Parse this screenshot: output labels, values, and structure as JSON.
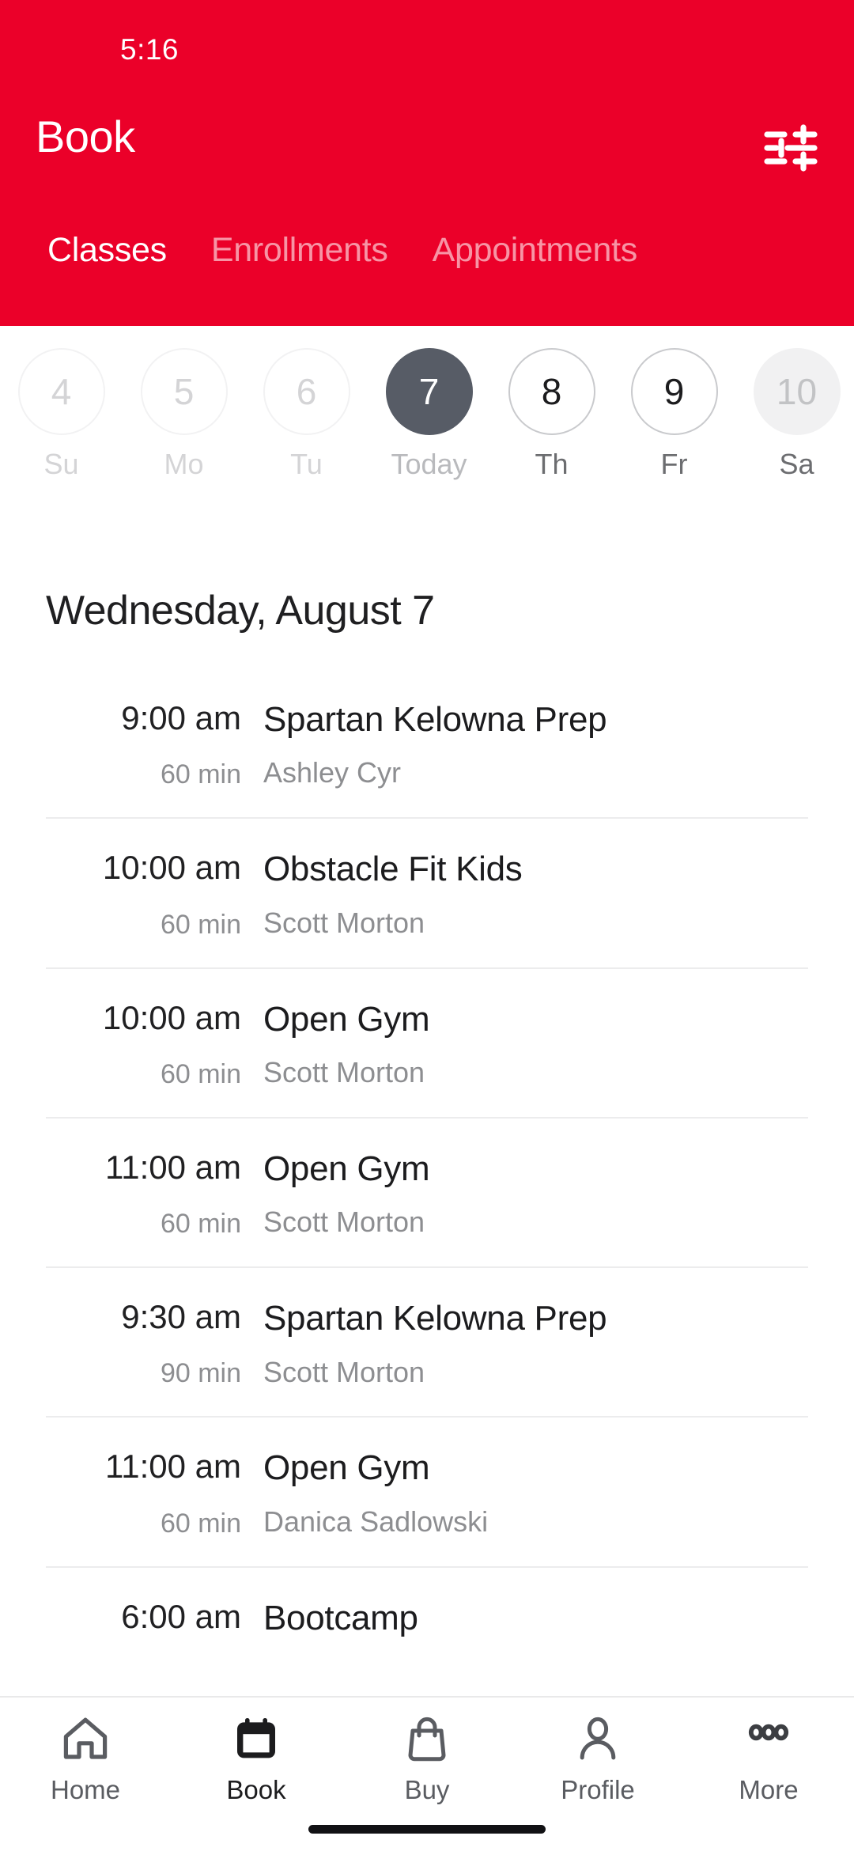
{
  "status_bar": {
    "time": "5:16"
  },
  "header": {
    "title": "Book",
    "accent_color": "#eb0029",
    "filter_icon": "sliders-filter-icon",
    "tabs": [
      {
        "label": "Classes",
        "active": true
      },
      {
        "label": "Enrollments",
        "active": false
      },
      {
        "label": "Appointments",
        "active": false
      }
    ]
  },
  "date_strip": {
    "days": [
      {
        "num": "4",
        "label": "Su",
        "state": "past"
      },
      {
        "num": "5",
        "label": "Mo",
        "state": "past"
      },
      {
        "num": "6",
        "label": "Tu",
        "state": "past"
      },
      {
        "num": "7",
        "label": "Today",
        "state": "sel"
      },
      {
        "num": "8",
        "label": "Th",
        "state": "future"
      },
      {
        "num": "9",
        "label": "Fr",
        "state": "future"
      },
      {
        "num": "10",
        "label": "Sa",
        "state": "dim"
      }
    ],
    "selected_color": "#575c66"
  },
  "schedule": {
    "heading": "Wednesday, August 7",
    "classes": [
      {
        "time": "9:00 am",
        "duration": "60 min",
        "title": "Spartan Kelowna Prep",
        "instructor": "Ashley Cyr"
      },
      {
        "time": "10:00 am",
        "duration": "60 min",
        "title": "Obstacle Fit Kids",
        "instructor": "Scott Morton"
      },
      {
        "time": "10:00 am",
        "duration": "60 min",
        "title": "Open Gym",
        "instructor": "Scott Morton"
      },
      {
        "time": "11:00 am",
        "duration": "60 min",
        "title": "Open Gym",
        "instructor": "Scott Morton"
      },
      {
        "time": "9:30 am",
        "duration": "90 min",
        "title": "Spartan Kelowna Prep",
        "instructor": "Scott Morton"
      },
      {
        "time": "11:00 am",
        "duration": "60 min",
        "title": "Open Gym",
        "instructor": "Danica Sadlowski"
      },
      {
        "time": "6:00 am",
        "duration": "",
        "title": "Bootcamp",
        "instructor": ""
      }
    ]
  },
  "bottom_nav": {
    "items": [
      {
        "label": "Home",
        "icon": "home-icon",
        "active": false
      },
      {
        "label": "Book",
        "icon": "calendar-icon",
        "active": true
      },
      {
        "label": "Buy",
        "icon": "shopping-bag-icon",
        "active": false
      },
      {
        "label": "Profile",
        "icon": "person-icon",
        "active": false
      },
      {
        "label": "More",
        "icon": "ellipsis-icon",
        "active": false
      }
    ]
  }
}
